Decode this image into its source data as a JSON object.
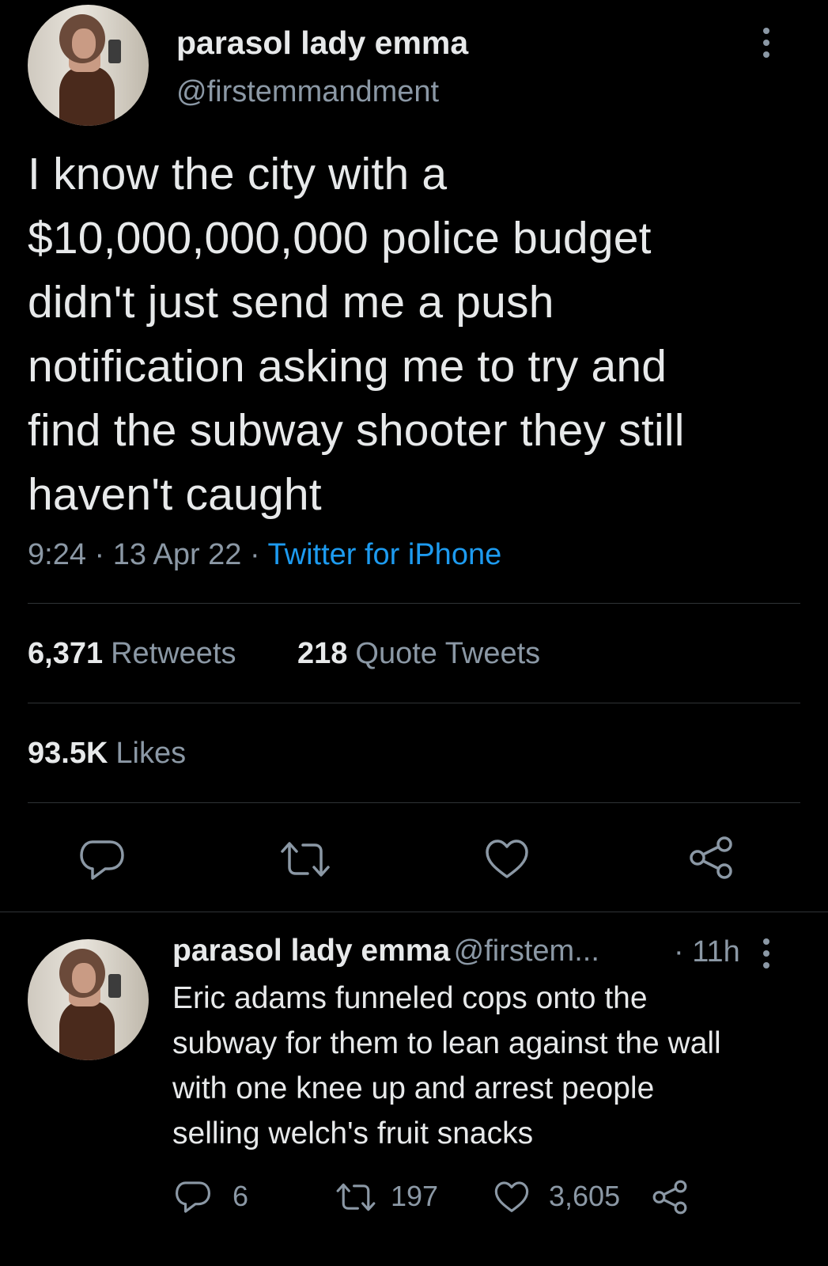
{
  "main_tweet": {
    "display_name": "parasol lady emma",
    "handle": "@firstemmandment",
    "text_lines": [
      "I know the city with a",
      "$10,000,000,000 police budget",
      "didn't just send me a push",
      "notification asking me to try and",
      "find the subway shooter they still",
      "haven't caught"
    ],
    "time": "9:24",
    "sep1": " · ",
    "date": "13 Apr 22",
    "sep2": " · ",
    "source": "Twitter for iPhone",
    "retweets_count": "6,371",
    "retweets_label": "Retweets",
    "quotes_count": "218",
    "quotes_label": "Quote Tweets",
    "likes_count": "93.5K",
    "likes_label": "Likes"
  },
  "reply": {
    "display_name": "parasol lady emma",
    "handle": "@firstem...",
    "age": "· 11h",
    "text_lines": [
      "Eric adams funneled cops onto the",
      "subway for them to lean against the wall",
      "with one knee up and arrest people",
      "selling welch's fruit snacks"
    ],
    "reply_count": "6",
    "retweet_count": "197",
    "like_count": "3,605"
  },
  "icons": {
    "more": "more-vertical-icon",
    "reply": "reply-icon",
    "retweet": "retweet-icon",
    "like": "heart-icon",
    "share": "share-icon"
  },
  "colors": {
    "background": "#000000",
    "text": "#e7e9ea",
    "secondary": "#8b98a5",
    "link": "#1d9bf0",
    "divider": "#2f3336"
  }
}
